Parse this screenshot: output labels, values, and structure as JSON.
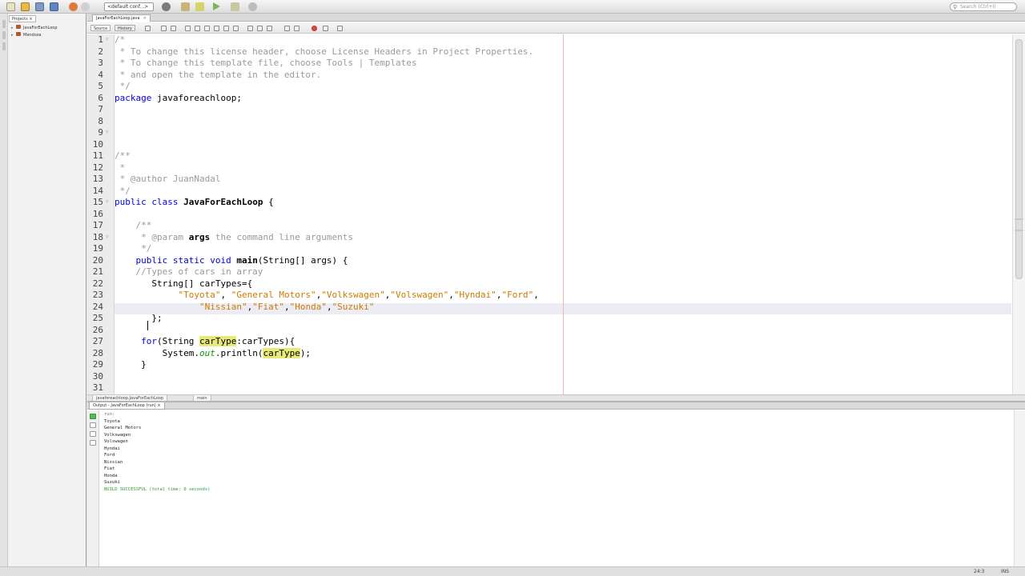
{
  "toolbar": {
    "config_select": "<default conf...>",
    "search_placeholder": "Search (Ctrl+I)"
  },
  "projects": {
    "tab_label": "Projects",
    "items": [
      {
        "label": "JavaForEachLoop",
        "icon": "coffee-icon"
      },
      {
        "label": "Mendoza",
        "icon": "coffee-icon"
      }
    ]
  },
  "editor": {
    "file_tab": "JavaForEachLoop.java",
    "source_tab": "Source",
    "history_tab": "History",
    "line_numbers": [
      "1",
      "2",
      "3",
      "4",
      "5",
      "6",
      "7",
      "8",
      "9",
      "10",
      "11",
      "12",
      "13",
      "14",
      "15",
      "16",
      "17",
      "18",
      "19",
      "20",
      "21",
      "22",
      "23",
      "24",
      "25",
      "26",
      "27",
      "28",
      "29",
      "30",
      "31"
    ],
    "breadcrumbs": [
      "javaforeachloop.JavaForEachLoop",
      "main"
    ]
  },
  "output": {
    "tab_label": "Output - JavaForEachLoop (run)",
    "run_line": "run:",
    "lines": [
      "Toyota",
      "General Motors",
      "Volkswagen",
      "Volswagen",
      "Hyndai",
      "Ford",
      "Nissian",
      "Fiat",
      "Honda",
      "Suzuki"
    ],
    "build_line": "BUILD SUCCESSFUL (total time: 0 seconds)"
  },
  "status": {
    "position": "24:3",
    "mode": "INS"
  },
  "colors": {
    "keyword": "#0000e6",
    "string": "#ce7b00",
    "comment": "#9a9a9a",
    "build_success": "#2a9a2a",
    "highlight": "#e9e97a"
  }
}
